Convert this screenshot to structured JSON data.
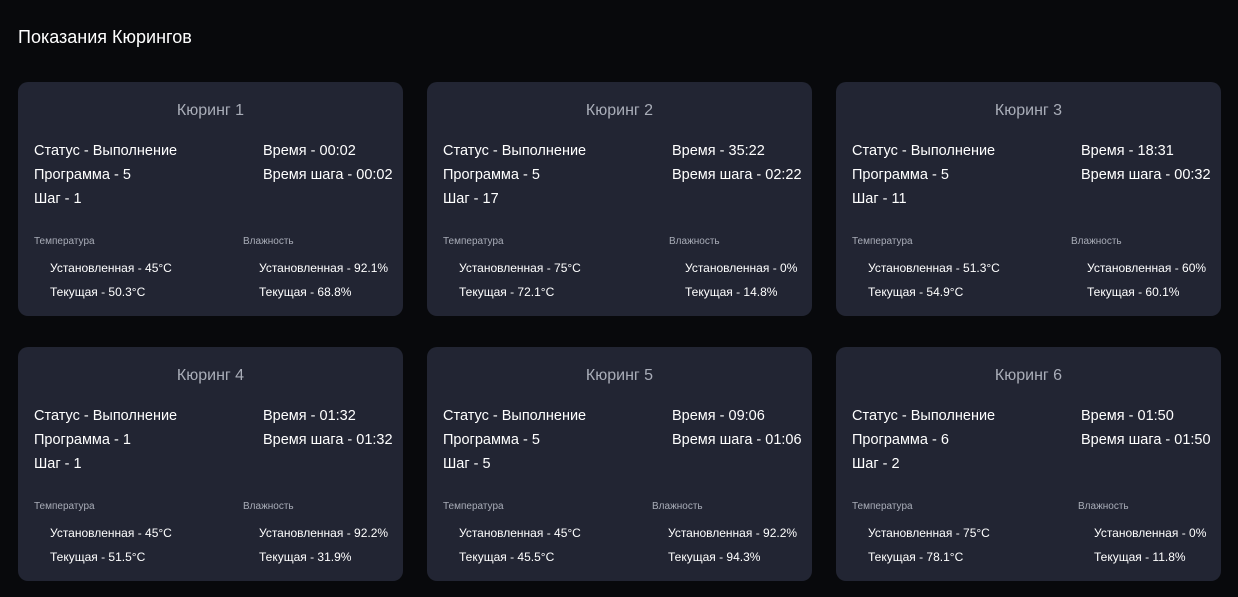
{
  "header": {
    "title": "Показания Кюрингов"
  },
  "labels": {
    "temperature": "Температура",
    "humidity": "Влажность"
  },
  "cards": [
    {
      "title": "Кюринг 1",
      "status": "Статус - Выполнение",
      "program": "Программа - 5",
      "step": "Шаг - 1",
      "time": "Время - 00:02",
      "step_time": "Время шага - 00:02",
      "temp_set": "Установленная - 45°C",
      "temp_current": "Текущая - 50.3°C",
      "hum_set": "Установленная - 92.1%",
      "hum_current": "Текущая - 68.8%"
    },
    {
      "title": "Кюринг 2",
      "status": "Статус - Выполнение",
      "program": "Программа - 5",
      "step": "Шаг - 17",
      "time": "Время - 35:22",
      "step_time": "Время шага - 02:22",
      "temp_set": "Установленная - 75°C",
      "temp_current": "Текущая - 72.1°C",
      "hum_set": "Установленная - 0%",
      "hum_current": "Текущая - 14.8%"
    },
    {
      "title": "Кюринг 3",
      "status": "Статус - Выполнение",
      "program": "Программа - 5",
      "step": "Шаг - 11",
      "time": "Время - 18:31",
      "step_time": "Время шага - 00:32",
      "temp_set": "Установленная - 51.3°C",
      "temp_current": "Текущая - 54.9°C",
      "hum_set": "Установленная - 60%",
      "hum_current": "Текущая - 60.1%"
    },
    {
      "title": "Кюринг 4",
      "status": "Статус - Выполнение",
      "program": "Программа - 1",
      "step": "Шаг - 1",
      "time": "Время - 01:32",
      "step_time": "Время шага - 01:32",
      "temp_set": "Установленная - 45°C",
      "temp_current": "Текущая - 51.5°C",
      "hum_set": "Установленная - 92.2%",
      "hum_current": "Текущая - 31.9%"
    },
    {
      "title": "Кюринг 5",
      "status": "Статус - Выполнение",
      "program": "Программа - 5",
      "step": "Шаг - 5",
      "time": "Время - 09:06",
      "step_time": "Время шага - 01:06",
      "temp_set": "Установленная - 45°C",
      "temp_current": "Текущая - 45.5°C",
      "hum_set": "Установленная - 92.2%",
      "hum_current": "Текущая - 94.3%"
    },
    {
      "title": "Кюринг 6",
      "status": "Статус - Выполнение",
      "program": "Программа - 6",
      "step": "Шаг - 2",
      "time": "Время - 01:50",
      "step_time": "Время шага - 01:50",
      "temp_set": "Установленная - 75°C",
      "temp_current": "Текущая - 78.1°C",
      "hum_set": "Установленная - 0%",
      "hum_current": "Текущая - 11.8%"
    }
  ]
}
